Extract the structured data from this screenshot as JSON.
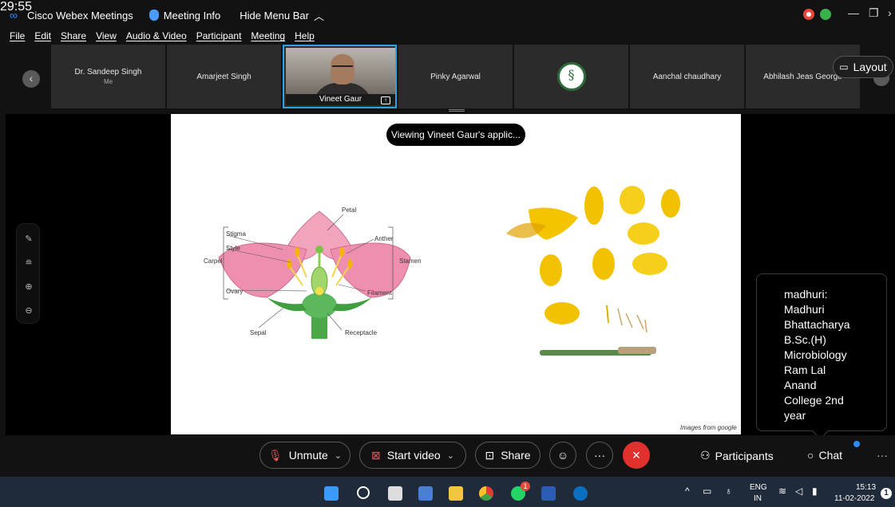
{
  "titlebar": {
    "app_title": "Cisco Webex Meetings",
    "meeting_info": "Meeting Info",
    "hide_menu": "Hide Menu Bar",
    "timer": "29:55"
  },
  "menu": [
    "File",
    "Edit",
    "Share",
    "View",
    "Audio & Video",
    "Participant",
    "Meeting",
    "Help"
  ],
  "participants": [
    {
      "name": "Dr. Sandeep Singh",
      "sub": "Me"
    },
    {
      "name": "Amarjeet Singh"
    },
    {
      "name": "Vineet Gaur"
    },
    {
      "name": "Pinky Agarwal"
    },
    {
      "name": ""
    },
    {
      "name": "Aanchal chaudhary"
    },
    {
      "name": "Abhilash Jeas George"
    }
  ],
  "layout_button": "Layout",
  "share_banner": "Viewing Vineet Gaur's applic...",
  "slide": {
    "labels": {
      "petal": "Petal",
      "stigma": "Stigma",
      "style": "Style",
      "anther": "Anther",
      "carpel": "Carpel",
      "stamen": "Stamen",
      "ovary": "Ovary",
      "filament": "Filament",
      "sepal": "Sepal",
      "receptacle": "Receptacle"
    },
    "credit": "Images from google"
  },
  "chat_popup": {
    "lines": [
      "madhuri:",
      "Madhuri",
      "Bhattacharya",
      "B.Sc.(H)",
      "Microbiology",
      "Ram Lal",
      "Anand",
      "College 2nd",
      "year"
    ]
  },
  "controls": {
    "unmute": "Unmute",
    "start_video": "Start video",
    "share": "Share",
    "more": "···",
    "participants": "Participants",
    "chat": "Chat",
    "overflow": "···"
  },
  "taskbar": {
    "whatsapp_badge": "1",
    "lang_top": "ENG",
    "lang_bottom": "IN",
    "time": "15:13",
    "date": "11-02-2022",
    "notifications": "1"
  },
  "colors": {
    "accent": "#2fa3e6",
    "end_call": "#e0312e",
    "recording": "#e8463a",
    "taskbar": "#1f2a3a"
  }
}
